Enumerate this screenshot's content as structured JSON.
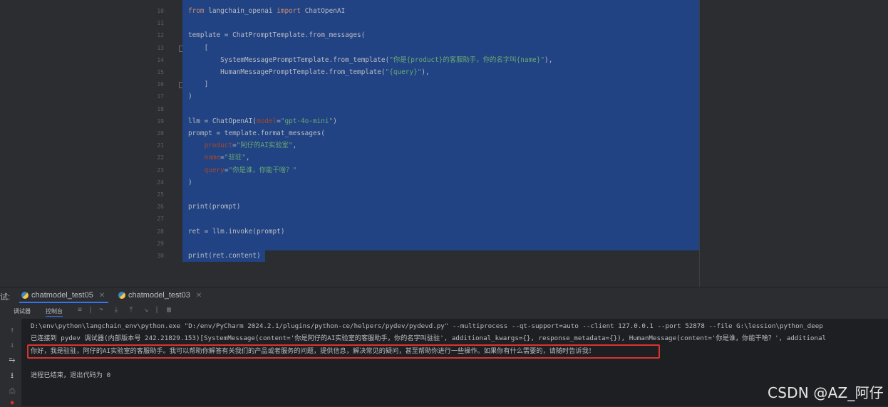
{
  "editor": {
    "line_numbers": [
      "10",
      "11",
      "12",
      "13",
      "14",
      "15",
      "16",
      "17",
      "18",
      "19",
      "20",
      "21",
      "22",
      "23",
      "24",
      "25",
      "26",
      "27",
      "28",
      "29",
      "30"
    ],
    "lines": [
      [
        {
          "t": "from ",
          "c": "kw"
        },
        {
          "t": "langchain_openai ",
          "c": "fn"
        },
        {
          "t": "import ",
          "c": "kw"
        },
        {
          "t": "ChatOpenAI",
          "c": "fn"
        }
      ],
      [],
      [
        {
          "t": "template = ChatPromptTemplate.from_messages(",
          "c": "fn"
        }
      ],
      [
        {
          "t": "    [",
          "c": "fn"
        }
      ],
      [
        {
          "t": "        SystemMessagePromptTemplate.from_template(",
          "c": "fn"
        },
        {
          "t": "\"你是{product}的客服助手，你的名字叫{name}\"",
          "c": "str"
        },
        {
          "t": "),",
          "c": "fn"
        }
      ],
      [
        {
          "t": "        HumanMessagePromptTemplate.from_template(",
          "c": "fn"
        },
        {
          "t": "\"{query}\"",
          "c": "str"
        },
        {
          "t": "),",
          "c": "fn"
        }
      ],
      [
        {
          "t": "    ]",
          "c": "fn"
        }
      ],
      [
        {
          "t": ")",
          "c": "fn"
        }
      ],
      [],
      [
        {
          "t": "llm = ChatOpenAI(",
          "c": "fn"
        },
        {
          "t": "model",
          "c": "pm"
        },
        {
          "t": "=",
          "c": "fn"
        },
        {
          "t": "\"gpt-4o-mini\"",
          "c": "str"
        },
        {
          "t": ")",
          "c": "fn"
        }
      ],
      [
        {
          "t": "prompt = template.format_messages(",
          "c": "fn"
        }
      ],
      [
        {
          "t": "    ",
          "c": "fn"
        },
        {
          "t": "product",
          "c": "pm"
        },
        {
          "t": "=",
          "c": "fn"
        },
        {
          "t": "\"阿仔的AI实验室\"",
          "c": "str"
        },
        {
          "t": ",",
          "c": "fn"
        }
      ],
      [
        {
          "t": "    ",
          "c": "fn"
        },
        {
          "t": "name",
          "c": "pm"
        },
        {
          "t": "=",
          "c": "fn"
        },
        {
          "t": "\"驻驻\"",
          "c": "str"
        },
        {
          "t": ",",
          "c": "fn"
        }
      ],
      [
        {
          "t": "    ",
          "c": "fn"
        },
        {
          "t": "query",
          "c": "pm"
        },
        {
          "t": "=",
          "c": "fn"
        },
        {
          "t": "\"你是谁，你能干啥？\"",
          "c": "str"
        }
      ],
      [
        {
          "t": ")",
          "c": "fn"
        }
      ],
      [],
      [
        {
          "t": "print",
          "c": "fn"
        },
        {
          "t": "(prompt)",
          "c": "fn"
        }
      ],
      [],
      [
        {
          "t": "ret = llm.invoke(prompt)",
          "c": "fn"
        }
      ],
      [],
      [
        {
          "t": "print",
          "c": "fn"
        },
        {
          "t": "(ret.content)",
          "c": "fn"
        }
      ]
    ]
  },
  "run_window": {
    "title": "试:",
    "tabs": [
      {
        "label": "chatmodel_test05",
        "active": true
      },
      {
        "label": "chatmodel_test03",
        "active": false
      }
    ],
    "toolbar": {
      "debugger_label": "调试器",
      "console_label": "控制台"
    },
    "console_lines": [
      "D:\\env\\python\\langchain_env\\python.exe \"D:/env/PyCharm 2024.2.1/plugins/python-ce/helpers/pydev/pydevd.py\" --multiprocess --qt-support=auto --client 127.0.0.1 --port 52878 --file G:\\lession\\python_deep",
      "已连接到 pydev 调试器(内部版本号 242.21829.153)[SystemMessage(content='你是阿仔的AI实验室的客服助手，你的名字叫驻驻', additional_kwargs={}, response_metadata={}), HumanMessage(content='你是谁，你能干啥？', additional",
      "你好，我是驻驻，阿仔的AI实验室的客服助手。我可以帮助你解答有关我们的产品或者服务的问题，提供信息，解决常见的疑问，甚至帮助你进行一些操作。如果你有什么需要的，请随时告诉我！",
      "",
      "进程已结束，退出代码为 0"
    ]
  },
  "watermark": "CSDN @AZ_阿仔",
  "colors": {
    "selection": "#214283",
    "highlight_box": "#d9342b",
    "tab_underline": "#3574f0"
  }
}
